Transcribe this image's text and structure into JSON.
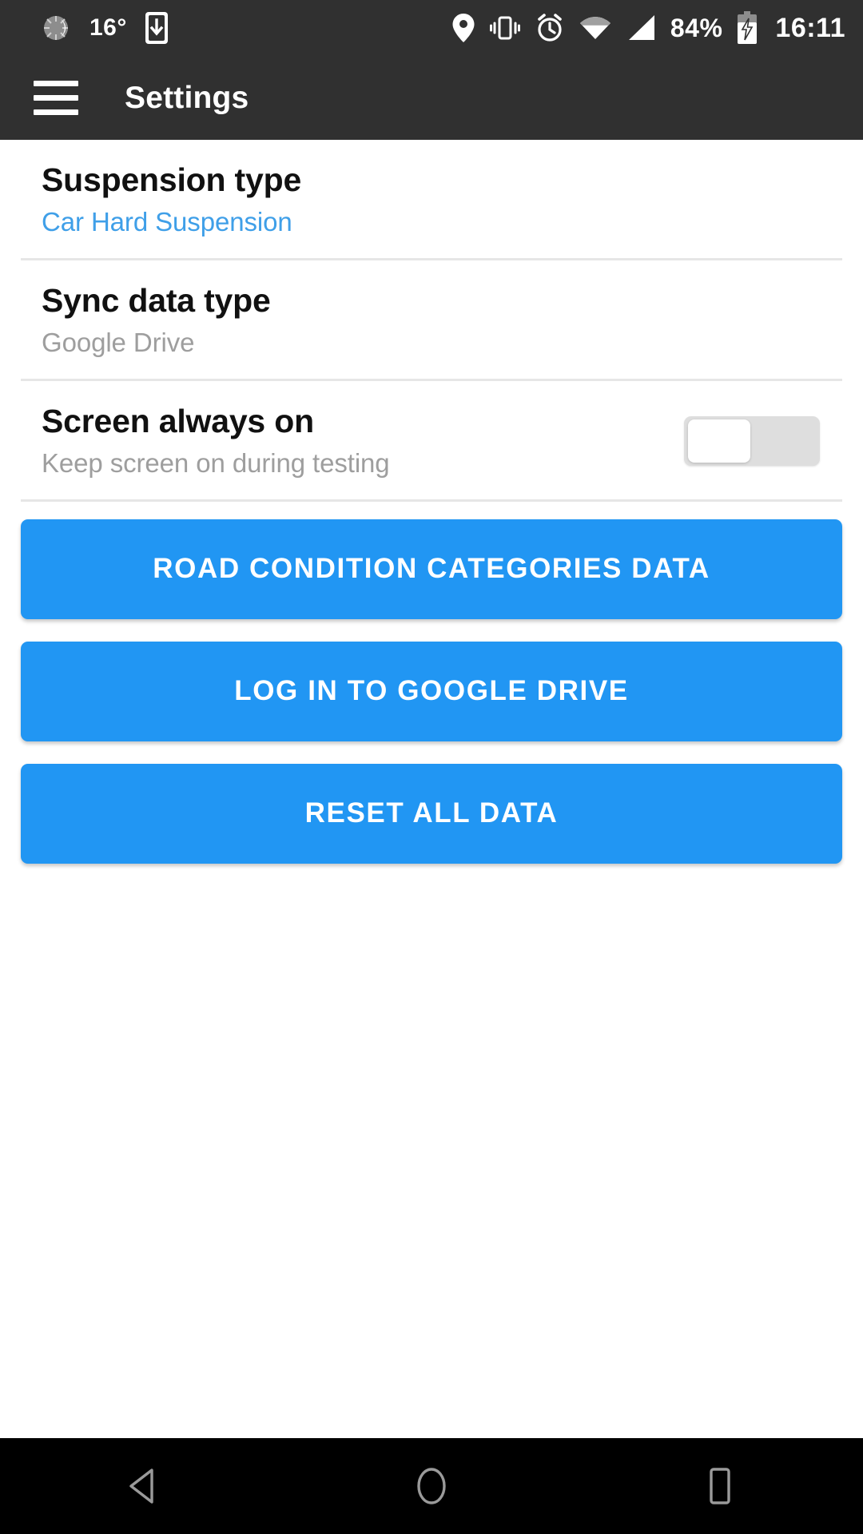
{
  "status_bar": {
    "weather_icon": "sun-dim-icon",
    "temperature": "16°",
    "download_icon": "phone-download-icon",
    "location_icon": "location-pin-icon",
    "vibrate_icon": "vibrate-icon",
    "alarm_icon": "alarm-clock-icon",
    "wifi_icon": "wifi-icon",
    "signal_icon": "cellular-signal-icon",
    "battery_percent": "84%",
    "battery_icon": "battery-charging-icon",
    "clock": "16:11"
  },
  "app_bar": {
    "menu_icon": "hamburger-menu-icon",
    "title": "Settings"
  },
  "settings": {
    "rows": [
      {
        "title": "Suspension type",
        "subtitle": "Car Hard Suspension",
        "subtitle_color": "#3f9fe8",
        "has_switch": false
      },
      {
        "title": "Sync data type",
        "subtitle": "Google Drive",
        "subtitle_color": "#9e9e9e",
        "has_switch": false
      },
      {
        "title": "Screen always on",
        "subtitle": "Keep screen on during testing",
        "subtitle_color": "#9e9e9e",
        "has_switch": true,
        "switch_state": "off"
      }
    ]
  },
  "buttons": [
    {
      "label": "ROAD CONDITION CATEGORIES DATA"
    },
    {
      "label": "LOG IN TO GOOGLE DRIVE"
    },
    {
      "label": "RESET ALL DATA"
    }
  ],
  "nav_bar": {
    "back_icon": "back-triangle-icon",
    "home_icon": "home-circle-icon",
    "recents_icon": "recents-square-icon"
  },
  "colors": {
    "accent": "#2196f3",
    "status_bar_bg": "#303030",
    "link": "#3f9fe8",
    "nav_bg": "#000000"
  }
}
